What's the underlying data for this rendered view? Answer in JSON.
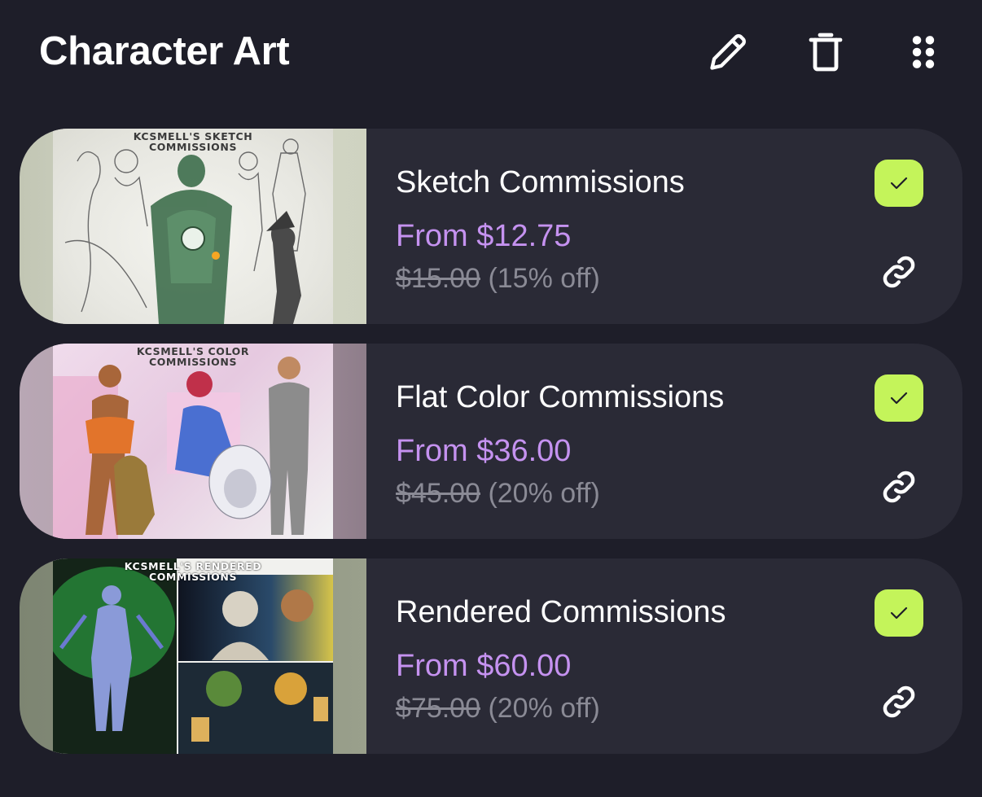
{
  "header": {
    "title": "Character Art",
    "icons": [
      "pencil-icon",
      "trash-icon",
      "drag-handle-icon"
    ]
  },
  "colors": {
    "background": "#1e1e29",
    "card": "#2a2a36",
    "price": "#c592f0",
    "original_price": "#8a8a95",
    "check_badge": "#c4f45a"
  },
  "items": [
    {
      "thumbnail_title": "KCSMELL'S SKETCH\nCOMMISSIONS",
      "name": "Sketch Commissions",
      "price": "From $12.75",
      "original_price": "$15.00",
      "discount": "(15% off)",
      "checked": true
    },
    {
      "thumbnail_title": "KCSMELL'S COLOR\nCOMMISSIONS",
      "name": "Flat Color Commissions",
      "price": "From $36.00",
      "original_price": "$45.00",
      "discount": "(20% off)",
      "checked": true
    },
    {
      "thumbnail_title": "KCSMELL'S RENDERED\nCOMMISSIONS",
      "name": "Rendered Commissions",
      "price": "From $60.00",
      "original_price": "$75.00",
      "discount": "(20% off)",
      "checked": true
    }
  ]
}
